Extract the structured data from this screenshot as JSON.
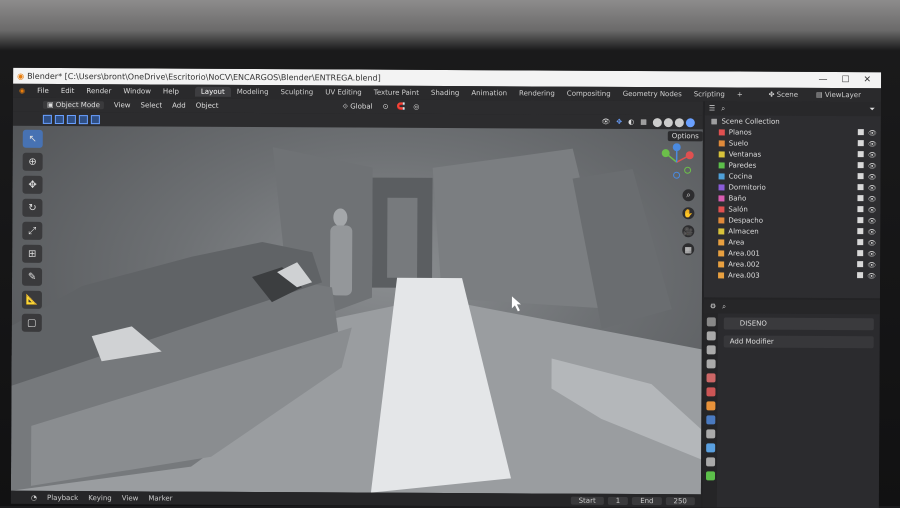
{
  "window": {
    "title": "Blender* [C:\\Users\\bront\\OneDrive\\Escritorio\\NoCV\\ENCARGOS\\Blender\\ENTREGA.blend]",
    "controls": [
      "—",
      "☐",
      "✕"
    ]
  },
  "menu": [
    "File",
    "Edit",
    "Render",
    "Window",
    "Help"
  ],
  "workspaces": [
    {
      "label": "Layout",
      "active": true
    },
    {
      "label": "Modeling"
    },
    {
      "label": "Sculpting"
    },
    {
      "label": "UV Editing"
    },
    {
      "label": "Texture Paint"
    },
    {
      "label": "Shading"
    },
    {
      "label": "Animation"
    },
    {
      "label": "Rendering"
    },
    {
      "label": "Compositing"
    },
    {
      "label": "Geometry Nodes"
    },
    {
      "label": "Scripting"
    }
  ],
  "add_workspace": "+",
  "scene": "Scene",
  "view_layer": "ViewLayer",
  "viewport_header": {
    "mode": "Object Mode",
    "items": [
      "View",
      "Select",
      "Add",
      "Object"
    ],
    "orientation": "Global"
  },
  "options_label": "Options",
  "timeline": {
    "items": [
      "Playback",
      "Keying",
      "View",
      "Marker"
    ],
    "start_label": "Start",
    "start": "1",
    "end_label": "End",
    "end": "250"
  },
  "outliner": {
    "root": "Scene Collection",
    "items": [
      {
        "label": "Planos",
        "color": "#e05050"
      },
      {
        "label": "Suelo",
        "color": "#e08a3a"
      },
      {
        "label": "Ventanas",
        "color": "#d8c23a"
      },
      {
        "label": "Paredes",
        "color": "#5cbf4a"
      },
      {
        "label": "Cocina",
        "color": "#4fa0d8"
      },
      {
        "label": "Dormitorio",
        "color": "#8a5cd8"
      },
      {
        "label": "Baño",
        "color": "#d85cb0"
      },
      {
        "label": "Salón",
        "color": "#e05050"
      },
      {
        "label": "Despacho",
        "color": "#e08a3a"
      },
      {
        "label": "Almacen",
        "color": "#d8c23a"
      },
      {
        "label": "Area",
        "color": "#e8a040"
      },
      {
        "label": "Area.001",
        "color": "#e8a040"
      },
      {
        "label": "Area.002",
        "color": "#e8a040"
      },
      {
        "label": "Area.003",
        "color": "#e8a040"
      }
    ]
  },
  "properties": {
    "object_name": "DISENO",
    "add_modifier": "Add Modifier"
  }
}
